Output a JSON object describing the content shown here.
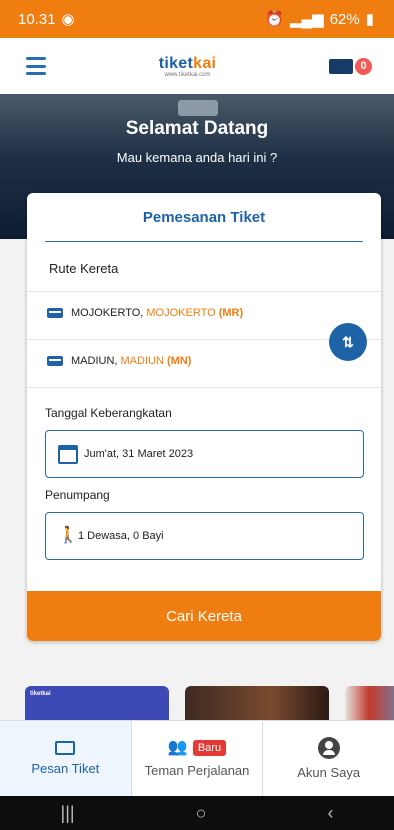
{
  "status_bar": {
    "time": "10.31",
    "battery": "62%",
    "bg_color": "#f07d10"
  },
  "app_bar": {
    "logo_text_a": "tiket",
    "logo_text_b": "kai",
    "logo_sub": "www.tiketkai.com",
    "cart_count": "0"
  },
  "hero": {
    "title": "Selamat Datang",
    "subtitle": "Mau kemana anda hari ini ?"
  },
  "booking": {
    "title": "Pemesanan Tiket",
    "route_title": "Rute Kereta",
    "origin": {
      "city": "MOJOKERTO, ",
      "city_name": "MOJOKERTO",
      "code": "(MR)"
    },
    "destination": {
      "city": "MADIUN, ",
      "city_name": "MADIUN",
      "code": "(MN)"
    },
    "date_label": "Tanggal Keberangkatan",
    "date_value": "Jum'at, 31 Maret 2023",
    "passenger_label": "Penumpang",
    "passenger_value": "1 Dewasa, 0 Bayi",
    "search_button": "Cari Kereta"
  },
  "promo": {
    "first_logo": "tiketkai"
  },
  "bottom_nav": {
    "items": [
      {
        "label": "Pesan Tiket",
        "icon": "ticket-icon",
        "active": true
      },
      {
        "label": "Teman Perjalanan",
        "icon": "people-icon",
        "badge": "Baru"
      },
      {
        "label": "Akun Saya",
        "icon": "user-icon"
      }
    ]
  },
  "colors": {
    "primary": "#1d63a6",
    "accent": "#f07d10",
    "badge_red": "#e53935"
  }
}
